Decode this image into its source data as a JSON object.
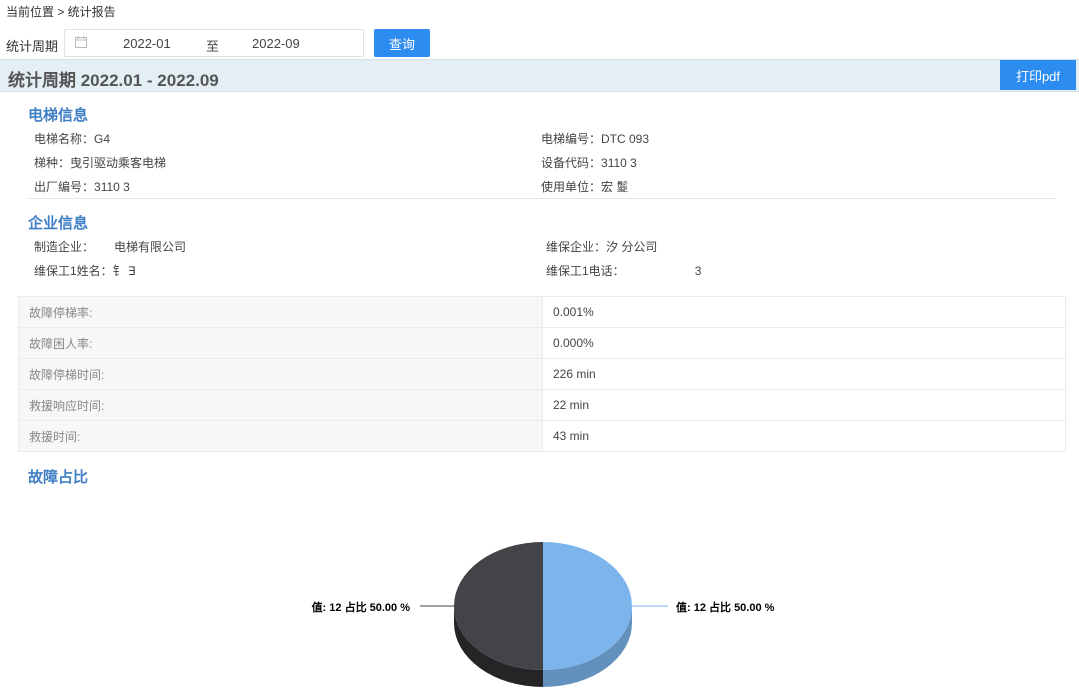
{
  "breadcrumb": "当前位置 > 统计报告",
  "filter": {
    "label": "统计周期",
    "start": "2022-01",
    "separator": "至",
    "end": "2022-09",
    "query_label": "查询"
  },
  "report": {
    "title": "统计周期 2022.01 - 2022.09",
    "print_label": "打印pdf"
  },
  "elevator_info": {
    "title": "电梯信息",
    "fields": [
      {
        "label": "电梯名称：",
        "value": "G4"
      },
      {
        "label": "电梯编号：",
        "value": "DTC  093"
      },
      {
        "label": "梯种：",
        "value": "曳引驱动乘客电梯"
      },
      {
        "label": "设备代码：",
        "value": "3110  3"
      },
      {
        "label": "出厂编号：",
        "value": "3110  3"
      },
      {
        "label": "使用单位：",
        "value": "宏  鬉"
      }
    ]
  },
  "company_info": {
    "title": "企业信息",
    "fields": [
      {
        "label": "制造企业：",
        "value": "电梯有限公司"
      },
      {
        "label": "维保企业：",
        "value": "汐  分公司"
      },
      {
        "label": "维保工1姓名：",
        "value": "钅  ∃"
      },
      {
        "label": "维保工1电话：",
        "value": "3"
      }
    ]
  },
  "metrics": [
    {
      "label": "故障停梯率:",
      "value": "0.001%"
    },
    {
      "label": "故障困人率:",
      "value": "0.000%"
    },
    {
      "label": "故障停梯时间:",
      "value": "226 min"
    },
    {
      "label": "救援响应时间:",
      "value": "22 min"
    },
    {
      "label": "救援时间:",
      "value": "43 min"
    }
  ],
  "fault_chart": {
    "title": "故障占比",
    "left_label": "值: 12 占比 50.00 %",
    "right_label": "值: 12 占比 50.00 %"
  },
  "colors": {
    "accent": "#2d8cf0",
    "section_title": "#3f7fc5",
    "report_bar": "#e3eef5"
  },
  "chart_data": {
    "type": "pie",
    "title": "",
    "slices": [
      {
        "value": 12,
        "percent": 50.0,
        "color": "#7cb5ec"
      },
      {
        "value": 12,
        "percent": 50.0,
        "color": "#434348"
      }
    ]
  }
}
